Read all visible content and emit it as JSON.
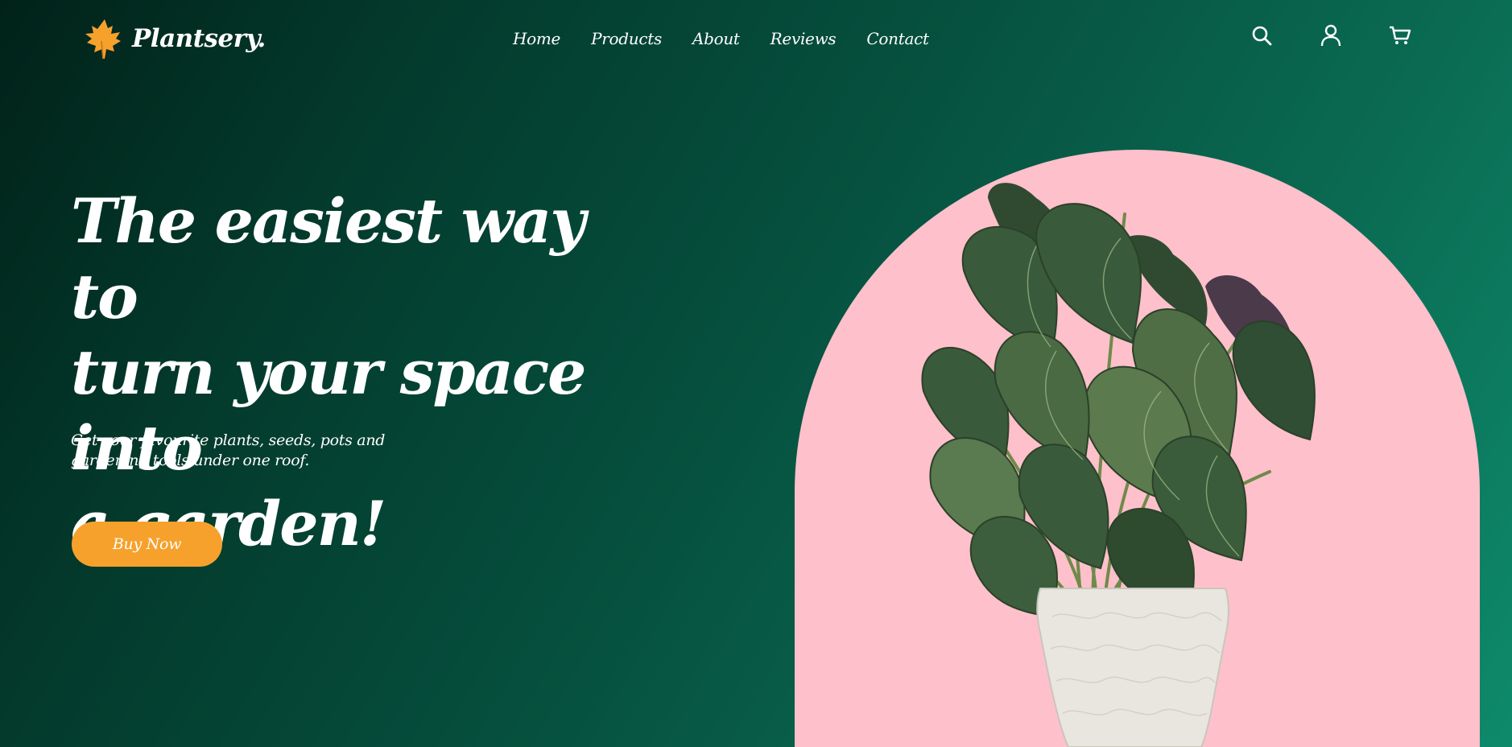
{
  "brand": {
    "name": "Plantsery.",
    "logo_icon": "maple-leaf-icon",
    "logo_color": "#f6a12c"
  },
  "nav": {
    "items": [
      {
        "label": "Home"
      },
      {
        "label": "Products"
      },
      {
        "label": "About"
      },
      {
        "label": "Reviews"
      },
      {
        "label": "Contact"
      }
    ]
  },
  "header_icons": [
    "search-icon",
    "user-icon",
    "cart-icon"
  ],
  "hero": {
    "title_lines": [
      "The easiest way to",
      "turn your space into",
      "a garden!"
    ],
    "subtitle_lines": [
      "Get your favourite plants, seeds, pots and",
      "gardening tools under one roof."
    ],
    "cta_label": "Buy Now"
  },
  "colors": {
    "background_dark": "#012219",
    "background_light": "#0e8a6b",
    "accent": "#f6a12c",
    "arch": "#fec0cb",
    "text": "#ffffff"
  }
}
